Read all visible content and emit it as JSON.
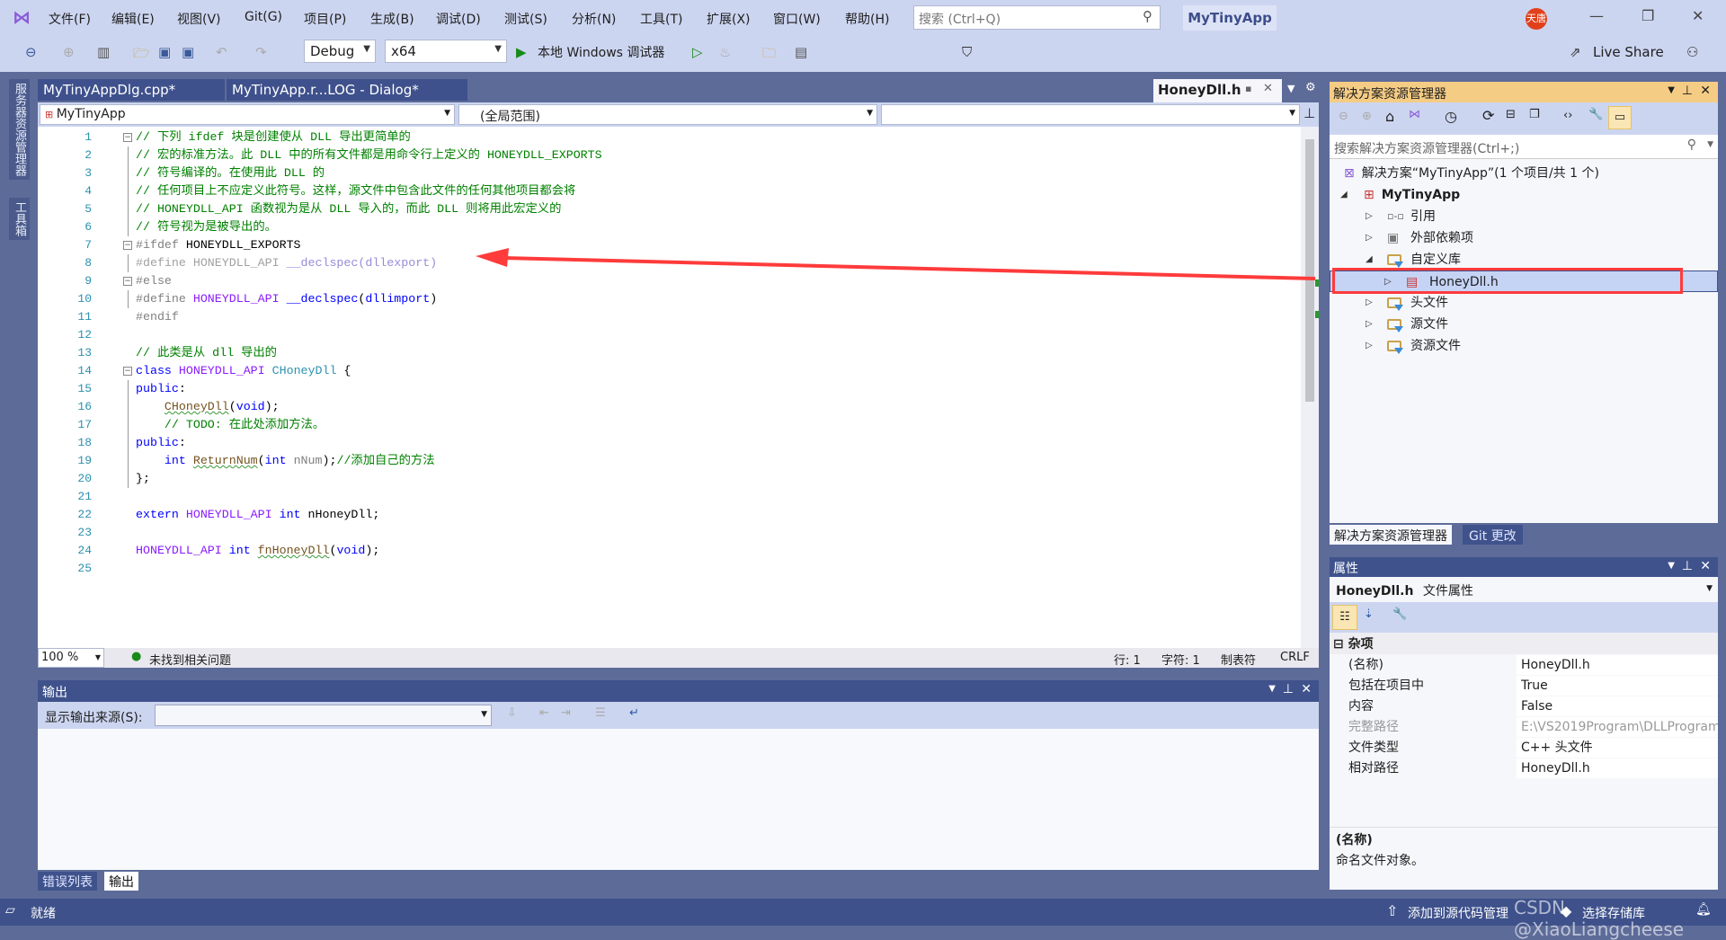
{
  "menu": {
    "items": [
      "文件(F)",
      "编辑(E)",
      "视图(V)",
      "Git(G)",
      "项目(P)",
      "生成(B)",
      "调试(D)",
      "测试(S)",
      "分析(N)",
      "工具(T)",
      "扩展(X)",
      "窗口(W)",
      "帮助(H)"
    ],
    "search_placeholder": "搜索 (Ctrl+Q)",
    "app_title": "MyTinyApp",
    "avatar_text": "天唐"
  },
  "toolbar": {
    "config": "Debug",
    "platform": "x64",
    "debugger": "本地 Windows 调试器",
    "live_share": "Live Share"
  },
  "left_strip": {
    "tabs": [
      "服务器资源管理器",
      "工具箱"
    ]
  },
  "editor": {
    "tabs": [
      "MyTinyAppDlg.cpp*",
      "MyTinyApp.r...LOG - Dialog*"
    ],
    "active_tab": "HoneyDll.h",
    "nav": {
      "project": "MyTinyApp",
      "scope": "(全局范围)",
      "member": ""
    },
    "lines": [
      [
        [
          "c-cm",
          "// 下列 ifdef 块是创建使从 DLL 导出更简单的"
        ]
      ],
      [
        [
          "c-cm",
          "// 宏的标准方法。此 DLL 中的所有文件都是用命令行上定义的 HONEYDLL_EXPORTS"
        ]
      ],
      [
        [
          "c-cm",
          "// 符号编译的。在使用此 DLL 的"
        ]
      ],
      [
        [
          "c-cm",
          "// 任何项目上不应定义此符号。这样，源文件中包含此文件的任何其他项目都会将"
        ]
      ],
      [
        [
          "c-cm",
          "// HONEYDLL_API 函数视为是从 DLL 导入的，而此 DLL 则将用此宏定义的"
        ]
      ],
      [
        [
          "c-cm",
          "// 符号视为是被导出的。"
        ]
      ],
      [
        [
          "c-pp",
          "#ifdef "
        ],
        [
          "c-tx",
          "HONEYDLL_EXPORTS"
        ]
      ],
      [
        [
          "c-in",
          "#define HONEYDLL_API "
        ],
        [
          "c-inm",
          "__declspec(dllexport)"
        ]
      ],
      [
        [
          "c-pp",
          "#else"
        ]
      ],
      [
        [
          "c-pp",
          "#define "
        ],
        [
          "c-mc",
          "HONEYDLL_API "
        ],
        [
          "c-kw",
          "__declspec"
        ],
        [
          "c-tx",
          "("
        ],
        [
          "c-kw",
          "dllimport"
        ],
        [
          "c-tx",
          ")"
        ]
      ],
      [
        [
          "c-pp",
          "#endif"
        ]
      ],
      [],
      [
        [
          "c-cm",
          "// 此类是从 dll 导出的"
        ]
      ],
      [
        [
          "c-kw",
          "class "
        ],
        [
          "c-mc",
          "HONEYDLL_API "
        ],
        [
          "c-cl",
          "CHoneyDll"
        ],
        [
          "c-tx",
          " {"
        ]
      ],
      [
        [
          "c-kw",
          "public"
        ],
        [
          "c-tx",
          ":"
        ]
      ],
      [
        [
          "c-tx",
          "    "
        ],
        [
          "c-fn squig",
          "CHoneyDll"
        ],
        [
          "c-tx",
          "("
        ],
        [
          "c-kw",
          "void"
        ],
        [
          "c-tx",
          ");"
        ]
      ],
      [
        [
          "c-tx",
          "    "
        ],
        [
          "c-cm",
          "// TODO: 在此处添加方法。"
        ]
      ],
      [
        [
          "c-kw",
          "public"
        ],
        [
          "c-tx",
          ":"
        ]
      ],
      [
        [
          "c-tx",
          "    "
        ],
        [
          "c-kw",
          "int "
        ],
        [
          "c-fn squig",
          "ReturnNum"
        ],
        [
          "c-tx",
          "("
        ],
        [
          "c-kw",
          "int "
        ],
        [
          "c-pa",
          "nNum"
        ],
        [
          "c-tx",
          ");"
        ],
        [
          "c-cm",
          "//添加自己的方法"
        ]
      ],
      [
        [
          "c-tx",
          "};"
        ]
      ],
      [],
      [
        [
          "c-kw",
          "extern "
        ],
        [
          "c-mc",
          "HONEYDLL_API "
        ],
        [
          "c-kw",
          "int "
        ],
        [
          "c-tx",
          "nHoneyDll;"
        ]
      ],
      [],
      [
        [
          "c-mc",
          "HONEYDLL_API "
        ],
        [
          "c-kw",
          "int "
        ],
        [
          "c-fn squig",
          "fnHoneyDll"
        ],
        [
          "c-tx",
          "("
        ],
        [
          "c-kw",
          "void"
        ],
        [
          "c-tx",
          ");"
        ]
      ],
      []
    ],
    "status": {
      "zoom": "100 %",
      "issues": "未找到相关问题",
      "line": "行: 1",
      "char": "字符: 1",
      "tabs": "制表符",
      "eol": "CRLF"
    }
  },
  "output": {
    "title": "输出",
    "source_label": "显示输出来源(S):",
    "source_value": "",
    "tabs": [
      "错误列表",
      "输出"
    ]
  },
  "statusbar": {
    "ready": "就绪",
    "add_source_control": "添加到源代码管理",
    "select_repo": "选择存储库",
    "watermark": "CSDN @XiaoLiangcheese"
  },
  "solution_explorer": {
    "title": "解决方案资源管理器",
    "search_placeholder": "搜索解决方案资源管理器(Ctrl+;)",
    "solution": "解决方案“MyTinyApp”(1 个项目/共 1 个)",
    "project": "MyTinyApp",
    "items": [
      {
        "label": "引用",
        "icon": "references-icon"
      },
      {
        "label": "外部依赖项",
        "icon": "external-deps-icon"
      },
      {
        "label": "自定义库",
        "icon": "filter-folder-icon"
      },
      {
        "label": "HoneyDll.h",
        "icon": "header-file-icon",
        "selected": true
      },
      {
        "label": "头文件",
        "icon": "filter-folder-icon"
      },
      {
        "label": "源文件",
        "icon": "filter-folder-icon"
      },
      {
        "label": "资源文件",
        "icon": "filter-folder-icon"
      }
    ],
    "bottom_tabs": [
      "解决方案资源管理器",
      "Git 更改"
    ]
  },
  "properties": {
    "title": "属性",
    "object": "HoneyDll.h",
    "object_type": "文件属性",
    "category": "杂项",
    "rows": [
      {
        "k": "(名称)",
        "v": "HoneyDll.h"
      },
      {
        "k": "包括在项目中",
        "v": "True"
      },
      {
        "k": "内容",
        "v": "False"
      },
      {
        "k": "完整路径",
        "v": "E:\\VS2019Program\\DLLProgram",
        "disabled": true
      },
      {
        "k": "文件类型",
        "v": "C++ 头文件"
      },
      {
        "k": "相对路径",
        "v": "HoneyDll.h"
      }
    ],
    "desc_title": "(名称)",
    "desc_text": "命名文件对象。"
  },
  "annotation": {
    "color": "#ff3b3b"
  },
  "colors": {
    "chrome": "#ccd5f0",
    "dock": "#5d6b99",
    "accent_header": "#3f528c",
    "se_header": "#f5cc84",
    "selection": "#c5d3f5"
  }
}
